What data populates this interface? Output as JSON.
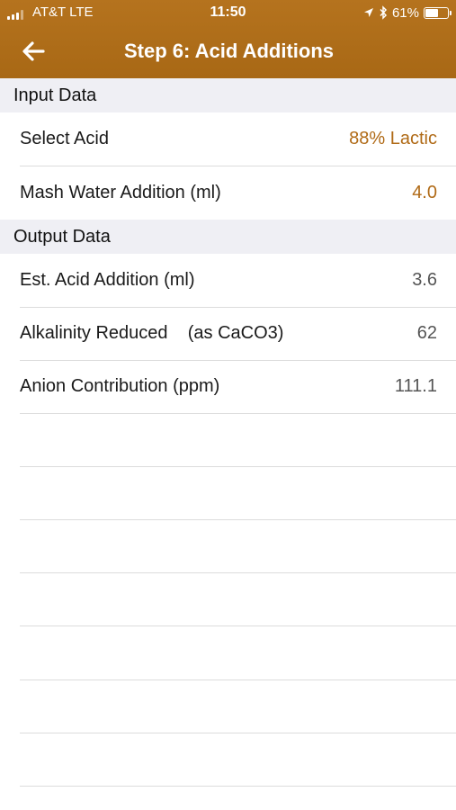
{
  "status_bar": {
    "carrier": "AT&T  LTE",
    "time": "11:50",
    "battery": "61%",
    "battery_level": 0.61,
    "icons": [
      "signal-bars-icon",
      "location-arrow-icon",
      "bluetooth-icon",
      "battery-icon"
    ]
  },
  "nav": {
    "title": "Step 6: Acid Additions",
    "back_icon": "back-arrow-icon"
  },
  "input_section": {
    "header": "Input Data",
    "rows": [
      {
        "label": "Select Acid",
        "value": "88% Lactic"
      },
      {
        "label": "Mash Water Addition (ml)",
        "value": "4.0"
      }
    ]
  },
  "output_section": {
    "header": "Output Data",
    "rows": [
      {
        "label": "Est. Acid Addition (ml)",
        "value": "3.6"
      },
      {
        "label": "Alkalinity Reduced    (as CaCO3)",
        "value": "62"
      },
      {
        "label": "Anion Contribution (ppm)",
        "value": "111.1"
      }
    ]
  },
  "colors": {
    "header_bg": "#ab6b18",
    "accent_value": "#b06a16",
    "section_bg": "#efeff4"
  }
}
